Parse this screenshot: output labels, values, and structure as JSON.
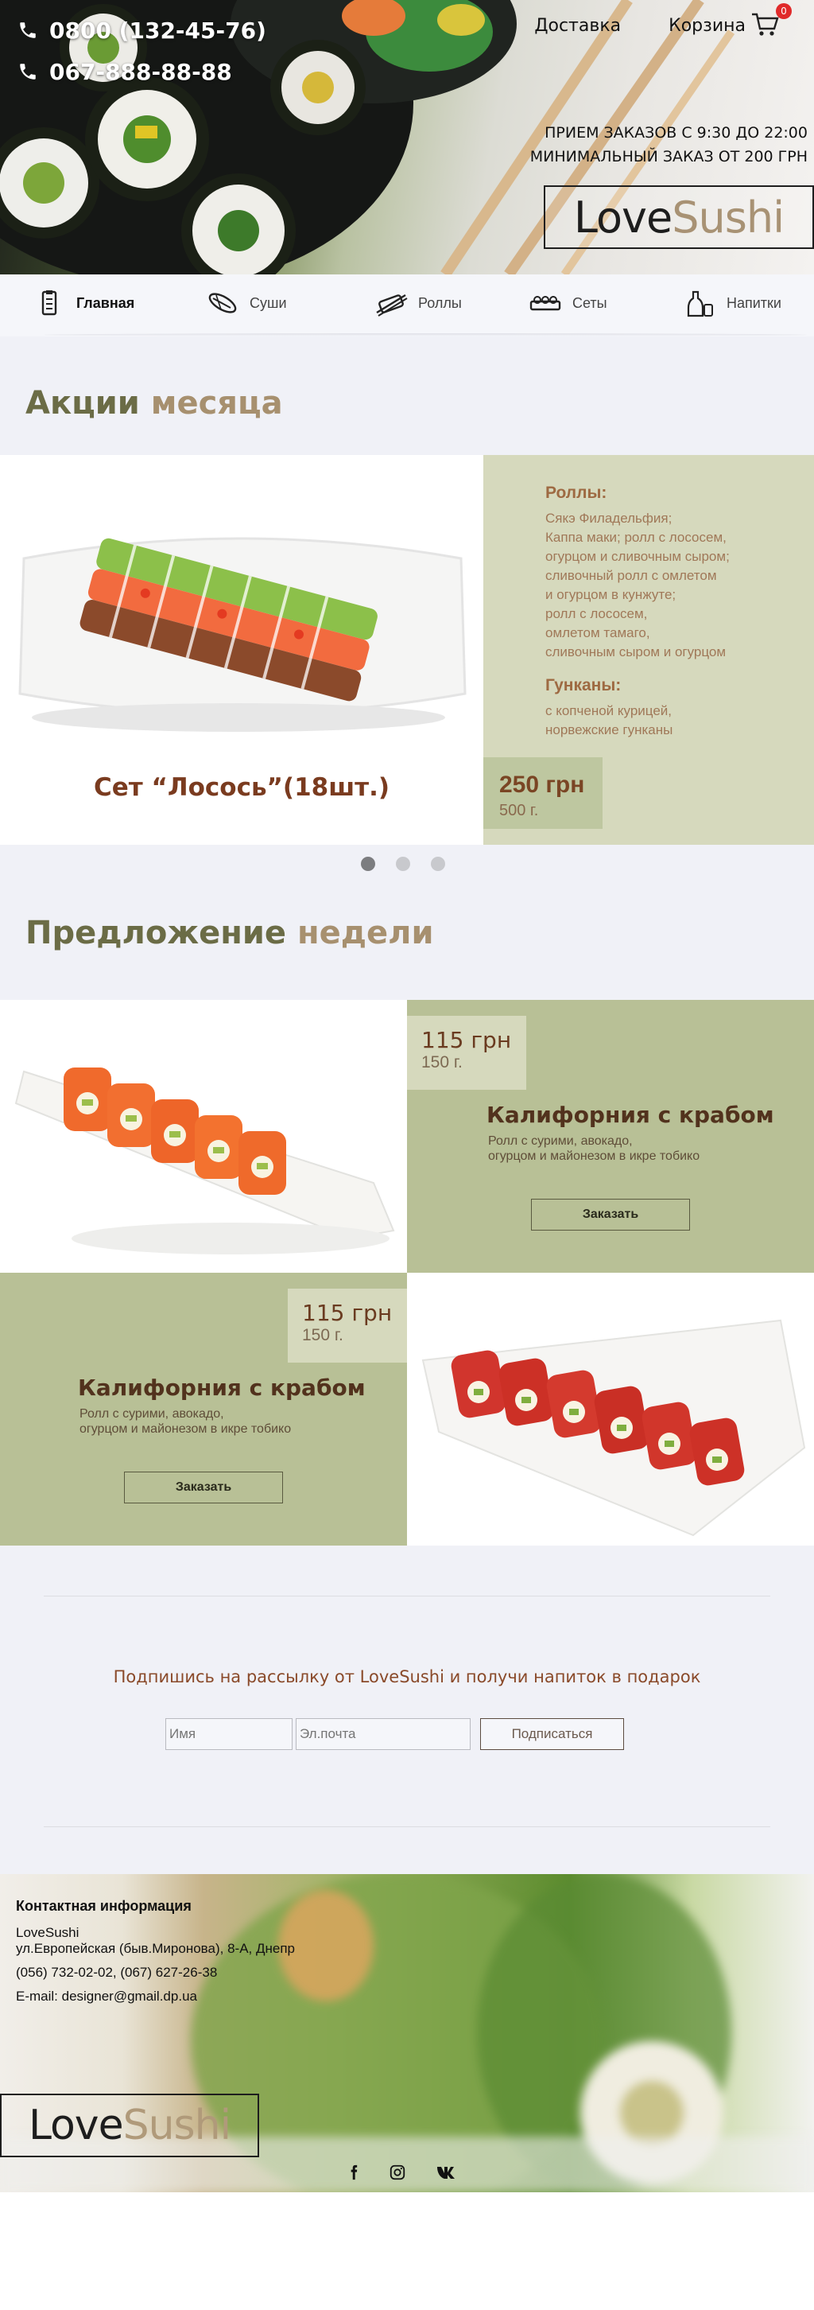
{
  "header": {
    "phone_1": "0800 (132-45-76)",
    "phone_2": "067-888-88-88",
    "links": {
      "delivery": "Доставка",
      "cart": "Корзина"
    },
    "cart_count": "0",
    "hours_line_1": "ПРИЕМ ЗАКАЗОВ С 9:30 ДО 22:00",
    "hours_line_2": "МИНИМАЛЬНЫЙ ЗАКАЗ ОТ 200 ГРН",
    "logo_part_1": "Love",
    "logo_part_2": "Sushi"
  },
  "nav": [
    {
      "label": "Главная",
      "icon": "clipboard-icon",
      "active": true
    },
    {
      "label": "Суши",
      "icon": "sushi-icon"
    },
    {
      "label": "Роллы",
      "icon": "rolls-icon"
    },
    {
      "label": "Сеты",
      "icon": "sets-icon"
    },
    {
      "label": "Напитки",
      "icon": "drinks-icon"
    }
  ],
  "promo": {
    "title_part_1": "Акции",
    "title_part_2": "месяца",
    "set_name": "Сет “Лосось”(18шт.)",
    "rolls_heading": "Роллы:",
    "rolls_lines": [
      "Сякэ Филадельфия;",
      "Каппа маки; ролл с лососем,",
      "огурцом и сливочным сыром;",
      "сливочный ролл с омлетом",
      "и огурцом в кунжуте;",
      "ролл с лососем,",
      "омлетом тамаго,",
      "сливочным сыром и огурцом"
    ],
    "gunkans_heading": "Гунканы:",
    "gunkans_lines": [
      "с копченой курицей,",
      "норвежские гунканы"
    ],
    "price": "250 грн",
    "weight": "500 г.",
    "slider_dots": 3,
    "active_dot": 1
  },
  "offer": {
    "title_part_1": "Предложение",
    "title_part_2": "недели",
    "items": [
      {
        "price": "115 грн",
        "weight": "150 г.",
        "name": "Калифорния с крабом",
        "desc_1": "Ролл с сурими, авокадо,",
        "desc_2": "огурцом и майонезом в икре тобико",
        "button": "Заказать"
      },
      {
        "price": "115 грн",
        "weight": "150 г.",
        "name": "Калифорния с крабом",
        "desc_1": "Ролл с сурими, авокадо,",
        "desc_2": "огурцом и майонезом в икре тобико",
        "button": "Заказать"
      }
    ]
  },
  "subscribe": {
    "title": "Подпишись на рассылку от LoveSushi и получи напиток в подарок",
    "name_placeholder": "Имя",
    "email_placeholder": "Эл.почта",
    "button": "Подписаться"
  },
  "footer": {
    "heading": "Контактная информация",
    "company": "LoveSushi",
    "address": "ул.Европейская (быв.Миронова), 8-А, Днепр",
    "phones": "(056) 732-02-02, (067) 627-26-38",
    "email": "E-mail: designer@gmail.dp.ua",
    "logo_part_1": "Love",
    "logo_part_2": "Sushi",
    "social": [
      "facebook-icon",
      "instagram-icon",
      "vk-icon"
    ]
  },
  "colors": {
    "olive_panel": "#b8c096",
    "light_olive": "#d6d9bd",
    "title_dark": "#6b6c46",
    "title_light": "#a7906f",
    "price_text": "#7a4524",
    "cart_badge": "#e02a2a"
  }
}
